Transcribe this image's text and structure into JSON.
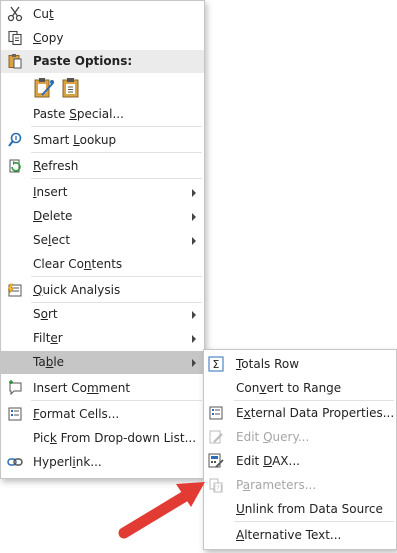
{
  "context_menu": {
    "cut": {
      "pre": "Cu",
      "ul": "t",
      "post": ""
    },
    "copy": {
      "pre": "",
      "ul": "C",
      "post": "opy"
    },
    "paste_options": {
      "pre": "Paste Options:"
    },
    "paste_special": {
      "pre": "Paste ",
      "ul": "S",
      "post": "pecial..."
    },
    "smart_lookup": {
      "pre": "Smart ",
      "ul": "L",
      "post": "ookup"
    },
    "refresh": {
      "pre": "",
      "ul": "R",
      "post": "efresh"
    },
    "insert": {
      "pre": "",
      "ul": "I",
      "post": "nsert"
    },
    "delete": {
      "pre": "",
      "ul": "D",
      "post": "elete"
    },
    "select": {
      "pre": "Se",
      "ul": "l",
      "post": "ect"
    },
    "clear_contents": {
      "pre": "Clear Co",
      "ul": "n",
      "post": "tents"
    },
    "quick_analysis": {
      "pre": "",
      "ul": "Q",
      "post": "uick Analysis"
    },
    "sort": {
      "pre": "S",
      "ul": "o",
      "post": "rt"
    },
    "filter": {
      "pre": "Filt",
      "ul": "e",
      "post": "r"
    },
    "table": {
      "pre": "Ta",
      "ul": "b",
      "post": "le"
    },
    "insert_comment": {
      "pre": "Insert Co",
      "ul": "m",
      "post": "ment"
    },
    "format_cells": {
      "pre": "",
      "ul": "F",
      "post": "ormat Cells..."
    },
    "pick_from_list": {
      "pre": "Pic",
      "ul": "k",
      "post": " From Drop-down List..."
    },
    "hyperlink": {
      "pre": "Hyperl",
      "ul": "i",
      "post": "nk..."
    }
  },
  "table_submenu": {
    "totals_row": {
      "pre": "",
      "ul": "T",
      "post": "otals Row"
    },
    "convert_to_range": {
      "pre": "Con",
      "ul": "v",
      "post": "ert to Range"
    },
    "external_data_properties": {
      "pre": "E",
      "ul": "x",
      "post": "ternal Data Properties..."
    },
    "edit_query": {
      "pre": "Edit ",
      "ul": "Q",
      "post": "uery..."
    },
    "edit_dax": {
      "pre": "Edit ",
      "ul": "D",
      "post": "AX..."
    },
    "parameters": {
      "pre": "P",
      "ul": "a",
      "post": "rameters..."
    },
    "unlink": {
      "pre": "",
      "ul": "U",
      "post": "nlink from Data Source"
    },
    "alternative_text": {
      "pre": "",
      "ul": "A",
      "post": "lternative Text..."
    }
  },
  "colors": {
    "arrow": "#e23b33",
    "highlight": "#c6c6c6",
    "disabled": "#a6a6a6"
  }
}
